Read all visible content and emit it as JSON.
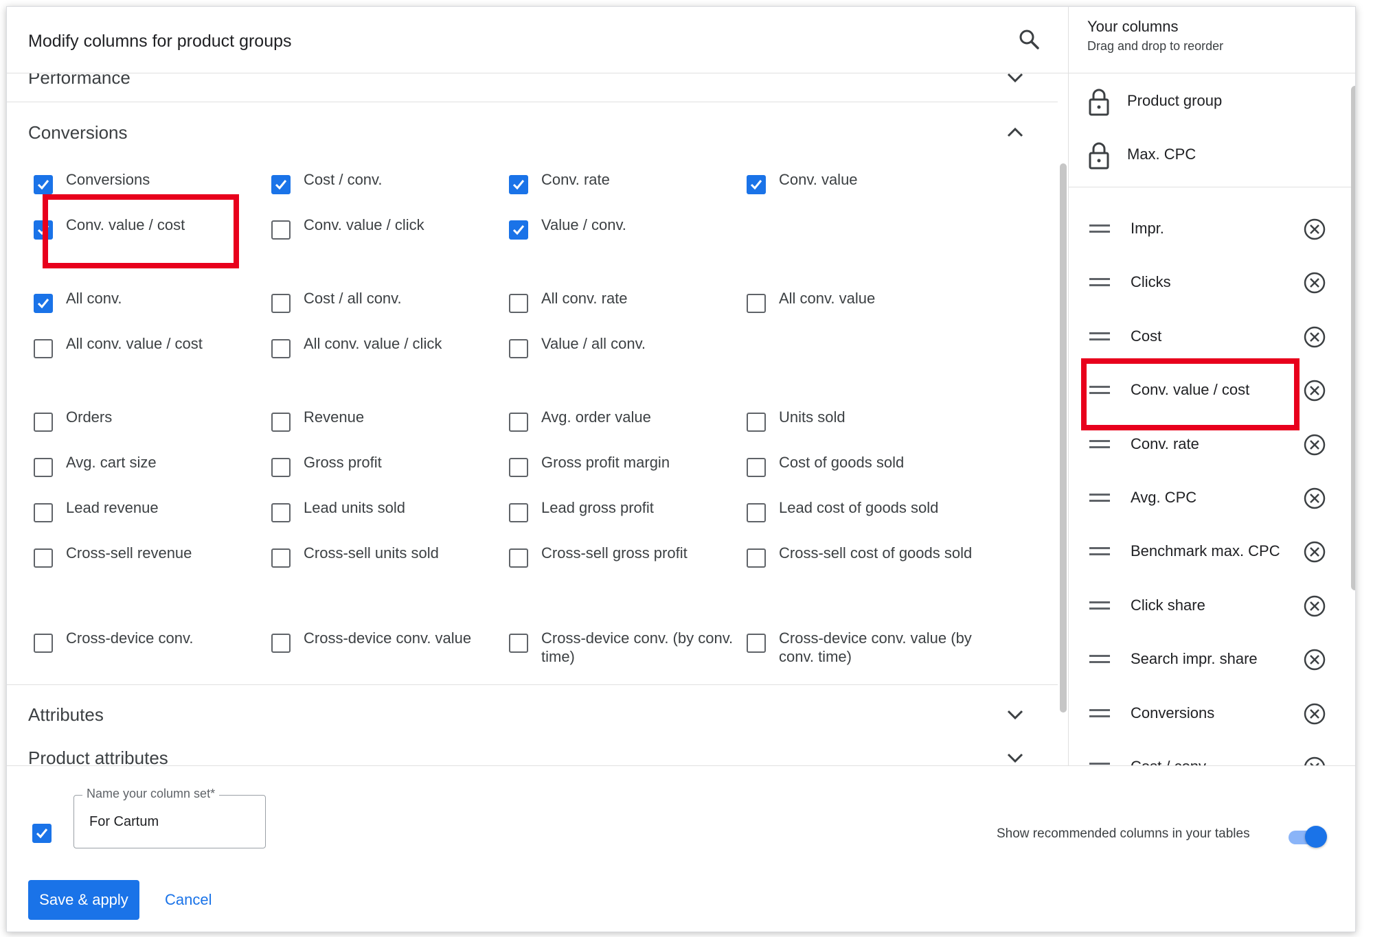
{
  "dialog": {
    "title": "Modify columns for product groups"
  },
  "sections": {
    "performance": "Performance",
    "conversions": "Conversions",
    "attributes": "Attributes",
    "product_attributes": "Product attributes"
  },
  "conversions_checkboxes": [
    {
      "label": "Conversions",
      "checked": true
    },
    {
      "label": "Cost / conv.",
      "checked": true
    },
    {
      "label": "Conv. rate",
      "checked": true
    },
    {
      "label": "Conv. value",
      "checked": true
    },
    {
      "label": "Conv. value / cost",
      "checked": true
    },
    {
      "label": "Conv. value / click",
      "checked": false
    },
    {
      "label": "Value / conv.",
      "checked": true
    },
    {
      "label": "All conv.",
      "checked": true
    },
    {
      "label": "Cost / all conv.",
      "checked": false
    },
    {
      "label": "All conv. rate",
      "checked": false
    },
    {
      "label": "All conv. value",
      "checked": false
    },
    {
      "label": "All conv. value / cost",
      "checked": false
    },
    {
      "label": "All conv. value / click",
      "checked": false
    },
    {
      "label": "Value / all conv.",
      "checked": false
    },
    {
      "label": "Orders",
      "checked": false
    },
    {
      "label": "Revenue",
      "checked": false
    },
    {
      "label": "Avg. order value",
      "checked": false
    },
    {
      "label": "Units sold",
      "checked": false
    },
    {
      "label": "Avg. cart size",
      "checked": false
    },
    {
      "label": "Gross profit",
      "checked": false
    },
    {
      "label": "Gross profit margin",
      "checked": false
    },
    {
      "label": "Cost of goods sold",
      "checked": false
    },
    {
      "label": "Lead revenue",
      "checked": false
    },
    {
      "label": "Lead units sold",
      "checked": false
    },
    {
      "label": "Lead gross profit",
      "checked": false
    },
    {
      "label": "Lead cost of goods sold",
      "checked": false
    },
    {
      "label": "Cross-sell revenue",
      "checked": false
    },
    {
      "label": "Cross-sell units sold",
      "checked": false
    },
    {
      "label": "Cross-sell gross profit",
      "checked": false
    },
    {
      "label": "Cross-sell cost of goods sold",
      "checked": false
    },
    {
      "label": "Cross-device conv.",
      "checked": false
    },
    {
      "label": "Cross-device conv. value",
      "checked": false
    },
    {
      "label": "Cross-device conv. (by conv. time)",
      "checked": false
    },
    {
      "label": "Cross-device conv. value (by conv. time)",
      "checked": false
    }
  ],
  "your_columns": {
    "title": "Your columns",
    "subtitle": "Drag and drop to reorder",
    "locked": [
      "Product group",
      "Max. CPC"
    ],
    "columns": [
      "Impr.",
      "Clicks",
      "Cost",
      "Conv. value / cost",
      "Conv. rate",
      "Avg. CPC",
      "Benchmark max. CPC",
      "Click share",
      "Search impr. share",
      "Conversions",
      "Cost / conv."
    ]
  },
  "footer": {
    "save_set_checked": true,
    "column_set_label": "Name your column set*",
    "column_set_value": "For Cartum",
    "recommended_label": "Show recommended columns in your tables",
    "recommended_on": true,
    "save_label": "Save & apply",
    "cancel_label": "Cancel"
  },
  "colors": {
    "accent": "#1a73e8",
    "highlight": "#e8001c",
    "text": "#202124",
    "secondary_text": "#3c4043"
  }
}
